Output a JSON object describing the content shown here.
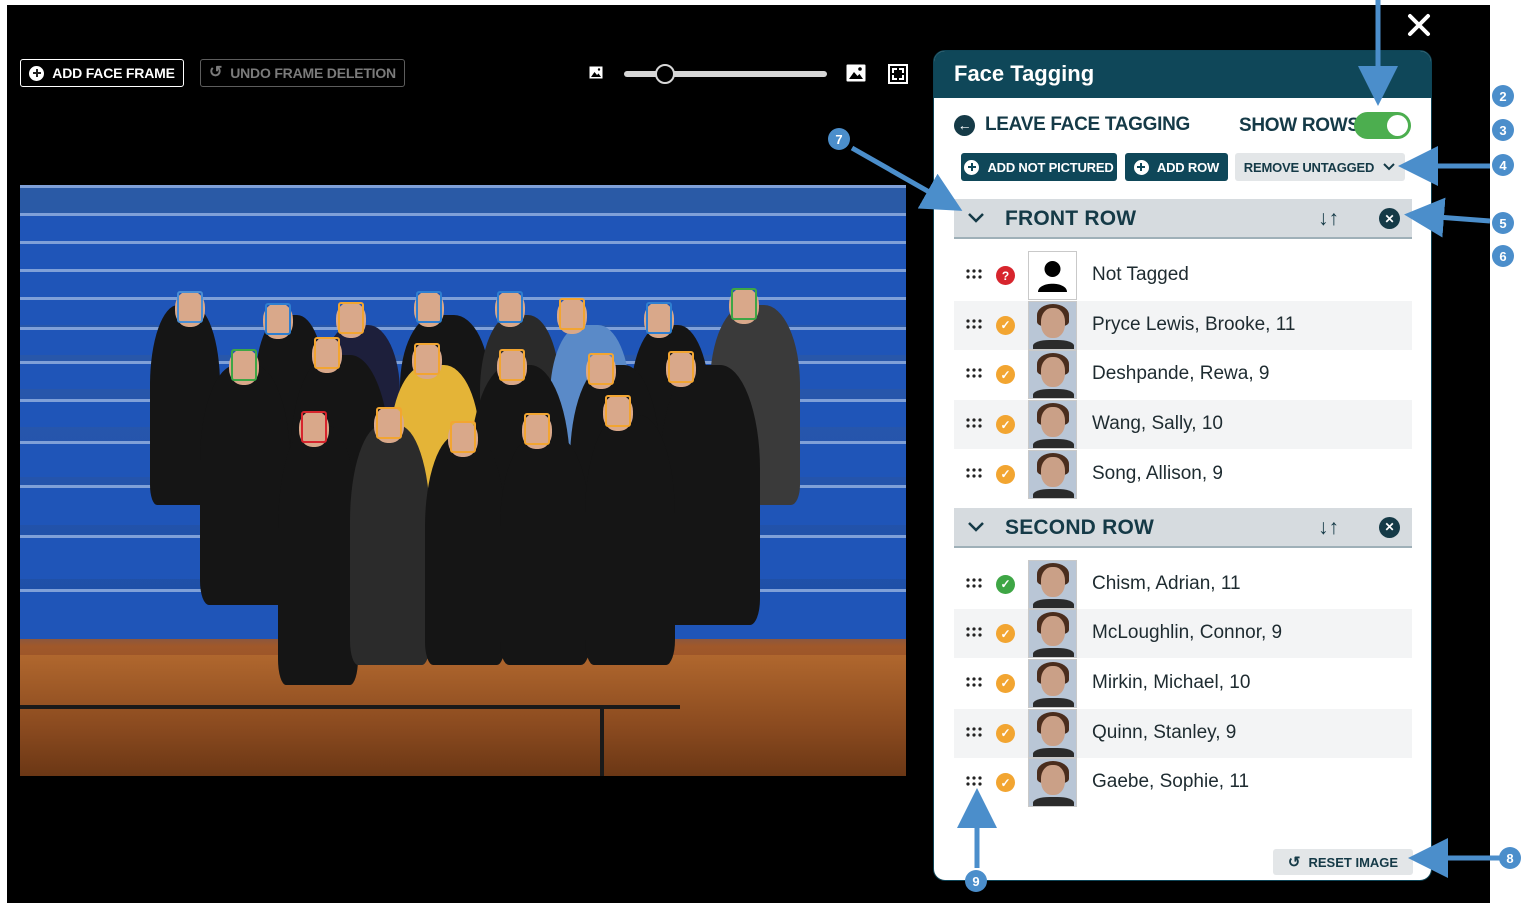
{
  "toolbar": {
    "add_face_frame": "ADD FACE FRAME",
    "undo_frame_deletion": "UNDO FRAME DELETION",
    "zoom_level": 0.2
  },
  "panel": {
    "title": "Face Tagging",
    "leave_label": "LEAVE FACE TAGGING",
    "show_rows_label": "SHOW ROWS",
    "show_rows_on": true,
    "add_not_pictured": "ADD NOT PICTURED",
    "add_row": "ADD ROW",
    "remove_untagged": "REMOVE UNTAGGED",
    "reset_image": "RESET IMAGE",
    "sort_glyph": "↓↑"
  },
  "rows": [
    {
      "title": "FRONT ROW",
      "people": [
        {
          "name": "Not Tagged",
          "status": "unknown"
        },
        {
          "name": "Pryce Lewis, Brooke, 11",
          "status": "pending"
        },
        {
          "name": "Deshpande, Rewa, 9",
          "status": "pending"
        },
        {
          "name": "Wang, Sally, 10",
          "status": "pending"
        },
        {
          "name": "Song, Allison, 9",
          "status": "pending"
        }
      ]
    },
    {
      "title": "SECOND ROW",
      "people": [
        {
          "name": "Chism, Adrian, 11",
          "status": "confirmed"
        },
        {
          "name": "McLoughlin, Connor, 9",
          "status": "pending"
        },
        {
          "name": "Mirkin, Michael, 10",
          "status": "pending"
        },
        {
          "name": "Quinn, Stanley, 9",
          "status": "pending"
        },
        {
          "name": "Gaebe, Sophie, 11",
          "status": "pending"
        }
      ]
    }
  ],
  "annotations": [
    "2",
    "3",
    "4",
    "5",
    "6",
    "7",
    "8",
    "9"
  ],
  "colors": {
    "panel_header": "#0f4759",
    "toggle_on": "#4cae4f",
    "status_pending": "#f2a531",
    "status_confirmed": "#3ea645",
    "status_unknown": "#d7252d",
    "annotation": "#4b8ecb",
    "frame_blue": "#2f7fd0",
    "frame_orange": "#f2a531",
    "frame_green": "#3ea645",
    "frame_red": "#d7252d"
  },
  "icons": {
    "add_frame": "plus-circle-icon",
    "undo": "undo-icon",
    "zoom_out": "image-small-icon",
    "zoom_in": "image-large-icon",
    "fullscreen": "fullscreen-icon",
    "close": "close-icon",
    "leave": "arrow-left-circle-icon",
    "collapse": "chevron-down-icon",
    "sort": "sort-arrows-icon",
    "remove_row": "x-circle-icon",
    "drag": "drag-handle-icon",
    "reset": "undo-icon"
  }
}
